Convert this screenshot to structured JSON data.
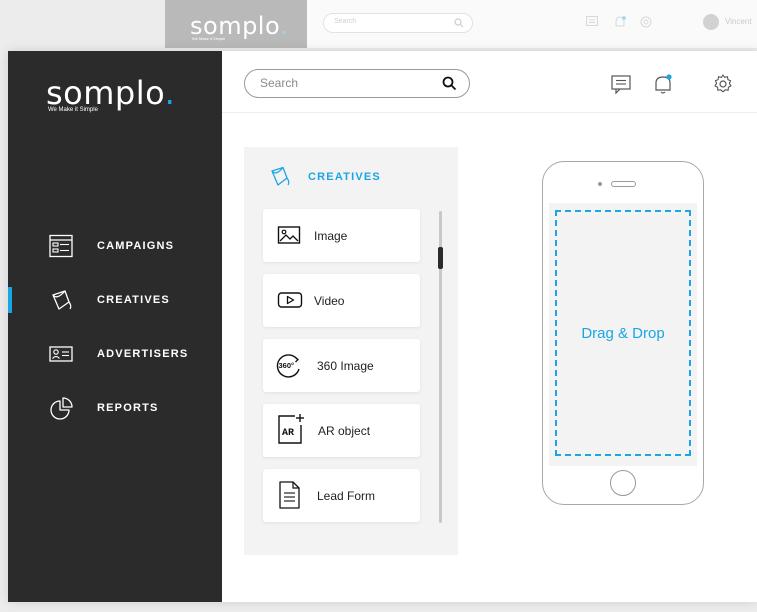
{
  "background_window": {
    "brand": "somplo",
    "tagline": "We Make it Simple",
    "search_placeholder": "Search",
    "user_name": "Vincent"
  },
  "brand": {
    "name": "somplo",
    "dot": ".",
    "tagline": "We Make it Simple",
    "accent": "#1aa6e4"
  },
  "sidebar": {
    "items": [
      {
        "label": "CAMPAIGNS",
        "icon": "campaigns-icon",
        "active": false
      },
      {
        "label": "CREATIVES",
        "icon": "paint-bucket-icon",
        "active": true
      },
      {
        "label": "ADVERTISERS",
        "icon": "id-card-icon",
        "active": false
      },
      {
        "label": "REPORTS",
        "icon": "pie-chart-icon",
        "active": false
      }
    ]
  },
  "header": {
    "search_placeholder": "Search",
    "icons": [
      "chat-icon",
      "notification-bell-icon",
      "settings-gear-icon"
    ]
  },
  "creatives_panel": {
    "title": "CREATIVES",
    "items": [
      {
        "label": "Image",
        "icon": "image-icon"
      },
      {
        "label": "Video",
        "icon": "video-icon"
      },
      {
        "label": "360 Image",
        "icon": "360-icon"
      },
      {
        "label": "AR object",
        "icon": "ar-icon"
      },
      {
        "label": "Lead Form",
        "icon": "document-icon"
      }
    ]
  },
  "preview": {
    "drop_text": "Drag & Drop"
  }
}
